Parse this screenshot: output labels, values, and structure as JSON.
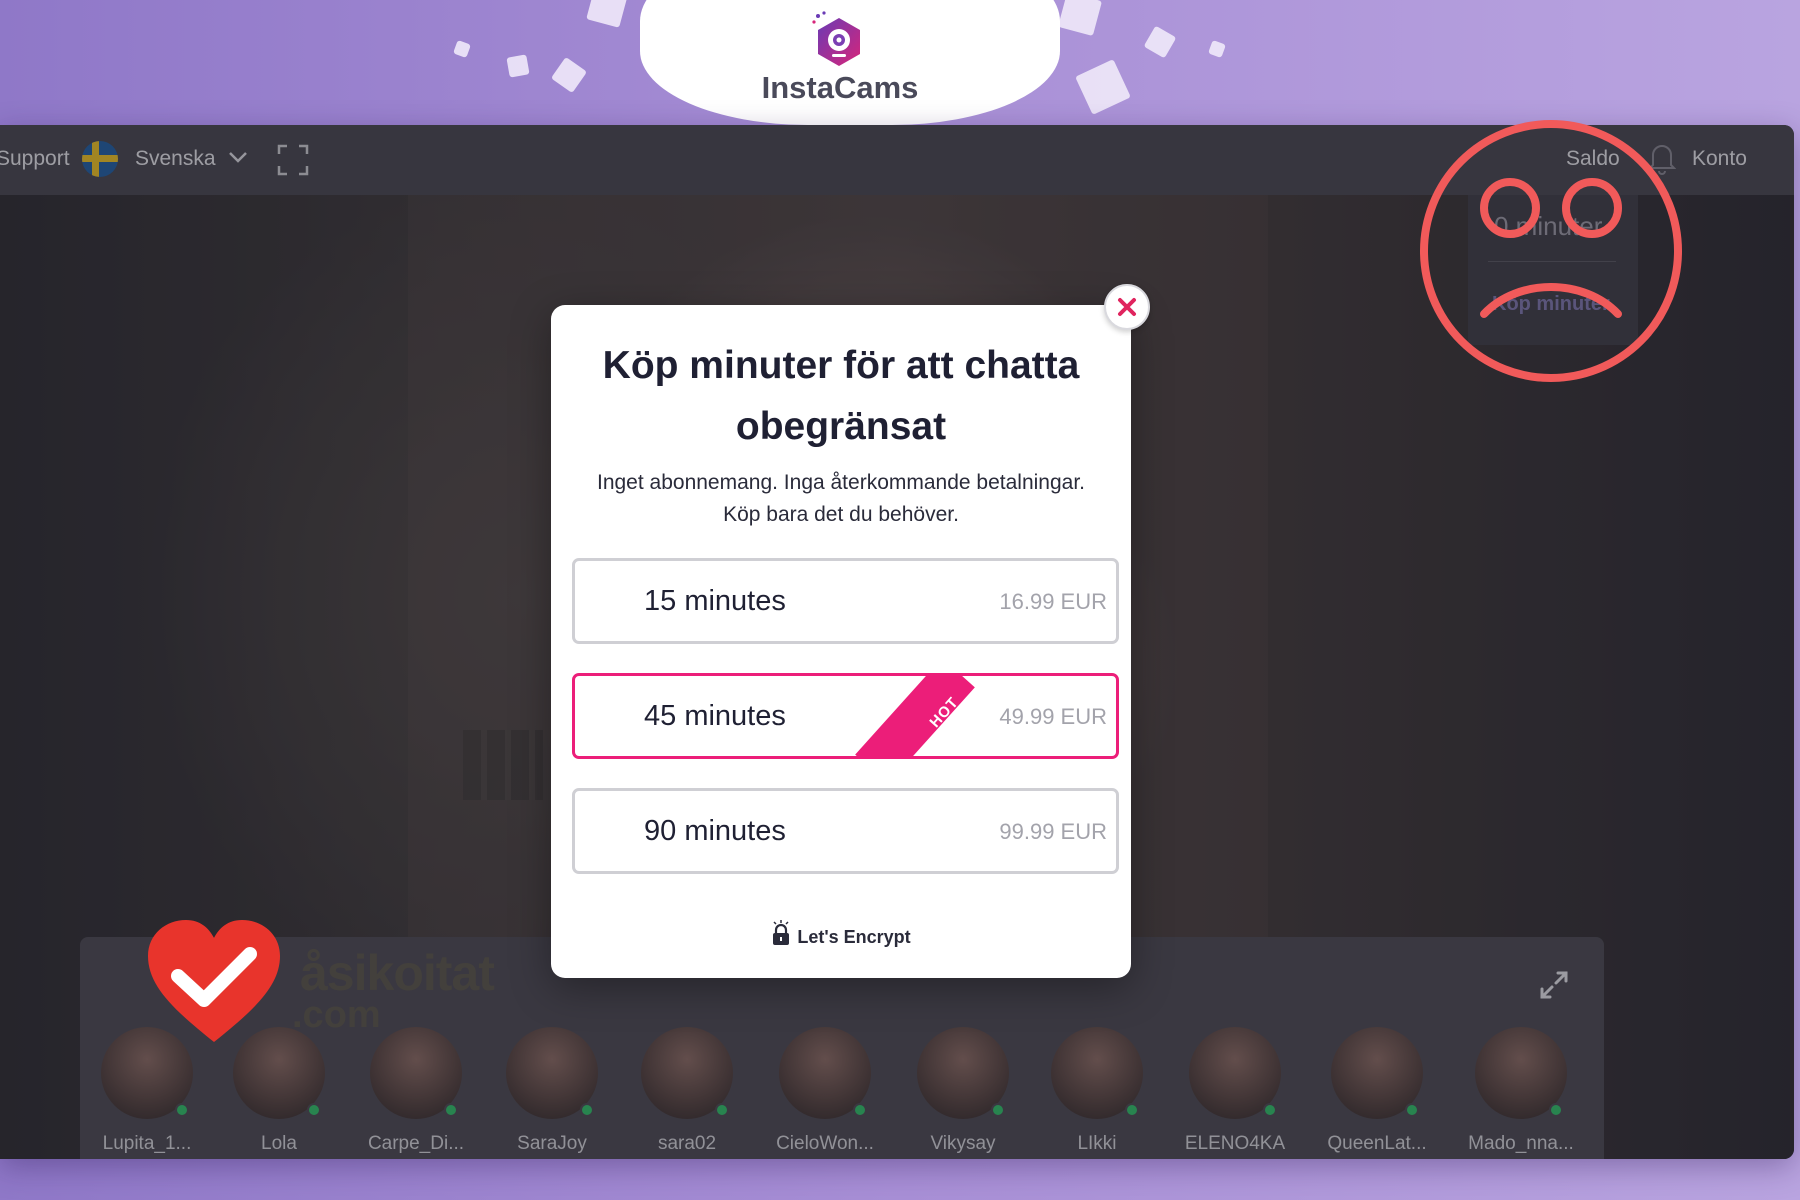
{
  "brand": {
    "name": "InstaCams"
  },
  "topbar": {
    "support_label": "Support",
    "language_label": "Svenska",
    "balance_label": "Saldo",
    "account_label": "Konto",
    "balance_dropdown": {
      "balance_value": "0 minuter",
      "buy_label": "Köp minuter"
    }
  },
  "modal": {
    "title": "Köp minuter för att chatta obegränsat",
    "subtitle_line1": "Inget abonnemang. Inga återkommande betalningar.",
    "subtitle_line2": "Köp bara det du behöver.",
    "options": [
      {
        "label": "15 minutes",
        "price": "16.99 EUR",
        "highlight": false
      },
      {
        "label": "45 minutes",
        "price": "49.99 EUR",
        "highlight": true,
        "badge": "HOT"
      },
      {
        "label": "90 minutes",
        "price": "99.99 EUR",
        "highlight": false
      }
    ],
    "security_label": "Let's Encrypt"
  },
  "models": [
    {
      "name": "Lupita_1...",
      "online": true
    },
    {
      "name": "Lola",
      "online": true
    },
    {
      "name": "Carpe_Di...",
      "online": true
    },
    {
      "name": "SaraJoy",
      "online": true
    },
    {
      "name": "sara02",
      "online": true
    },
    {
      "name": "CieloWon...",
      "online": true
    },
    {
      "name": "Vikysay",
      "online": true
    },
    {
      "name": "LIkki",
      "online": true
    },
    {
      "name": "ELENO4KA",
      "online": true
    },
    {
      "name": "QueenLat...",
      "online": true
    },
    {
      "name": "Mado_nna...",
      "online": true
    }
  ],
  "watermark": {
    "text": "åsikoitat",
    "domain": ".com"
  },
  "colors": {
    "accent": "#ec1e79",
    "brand_purple": "#7b3fb3",
    "sad_face": "#f15a5a",
    "online": "#2fc46a"
  }
}
